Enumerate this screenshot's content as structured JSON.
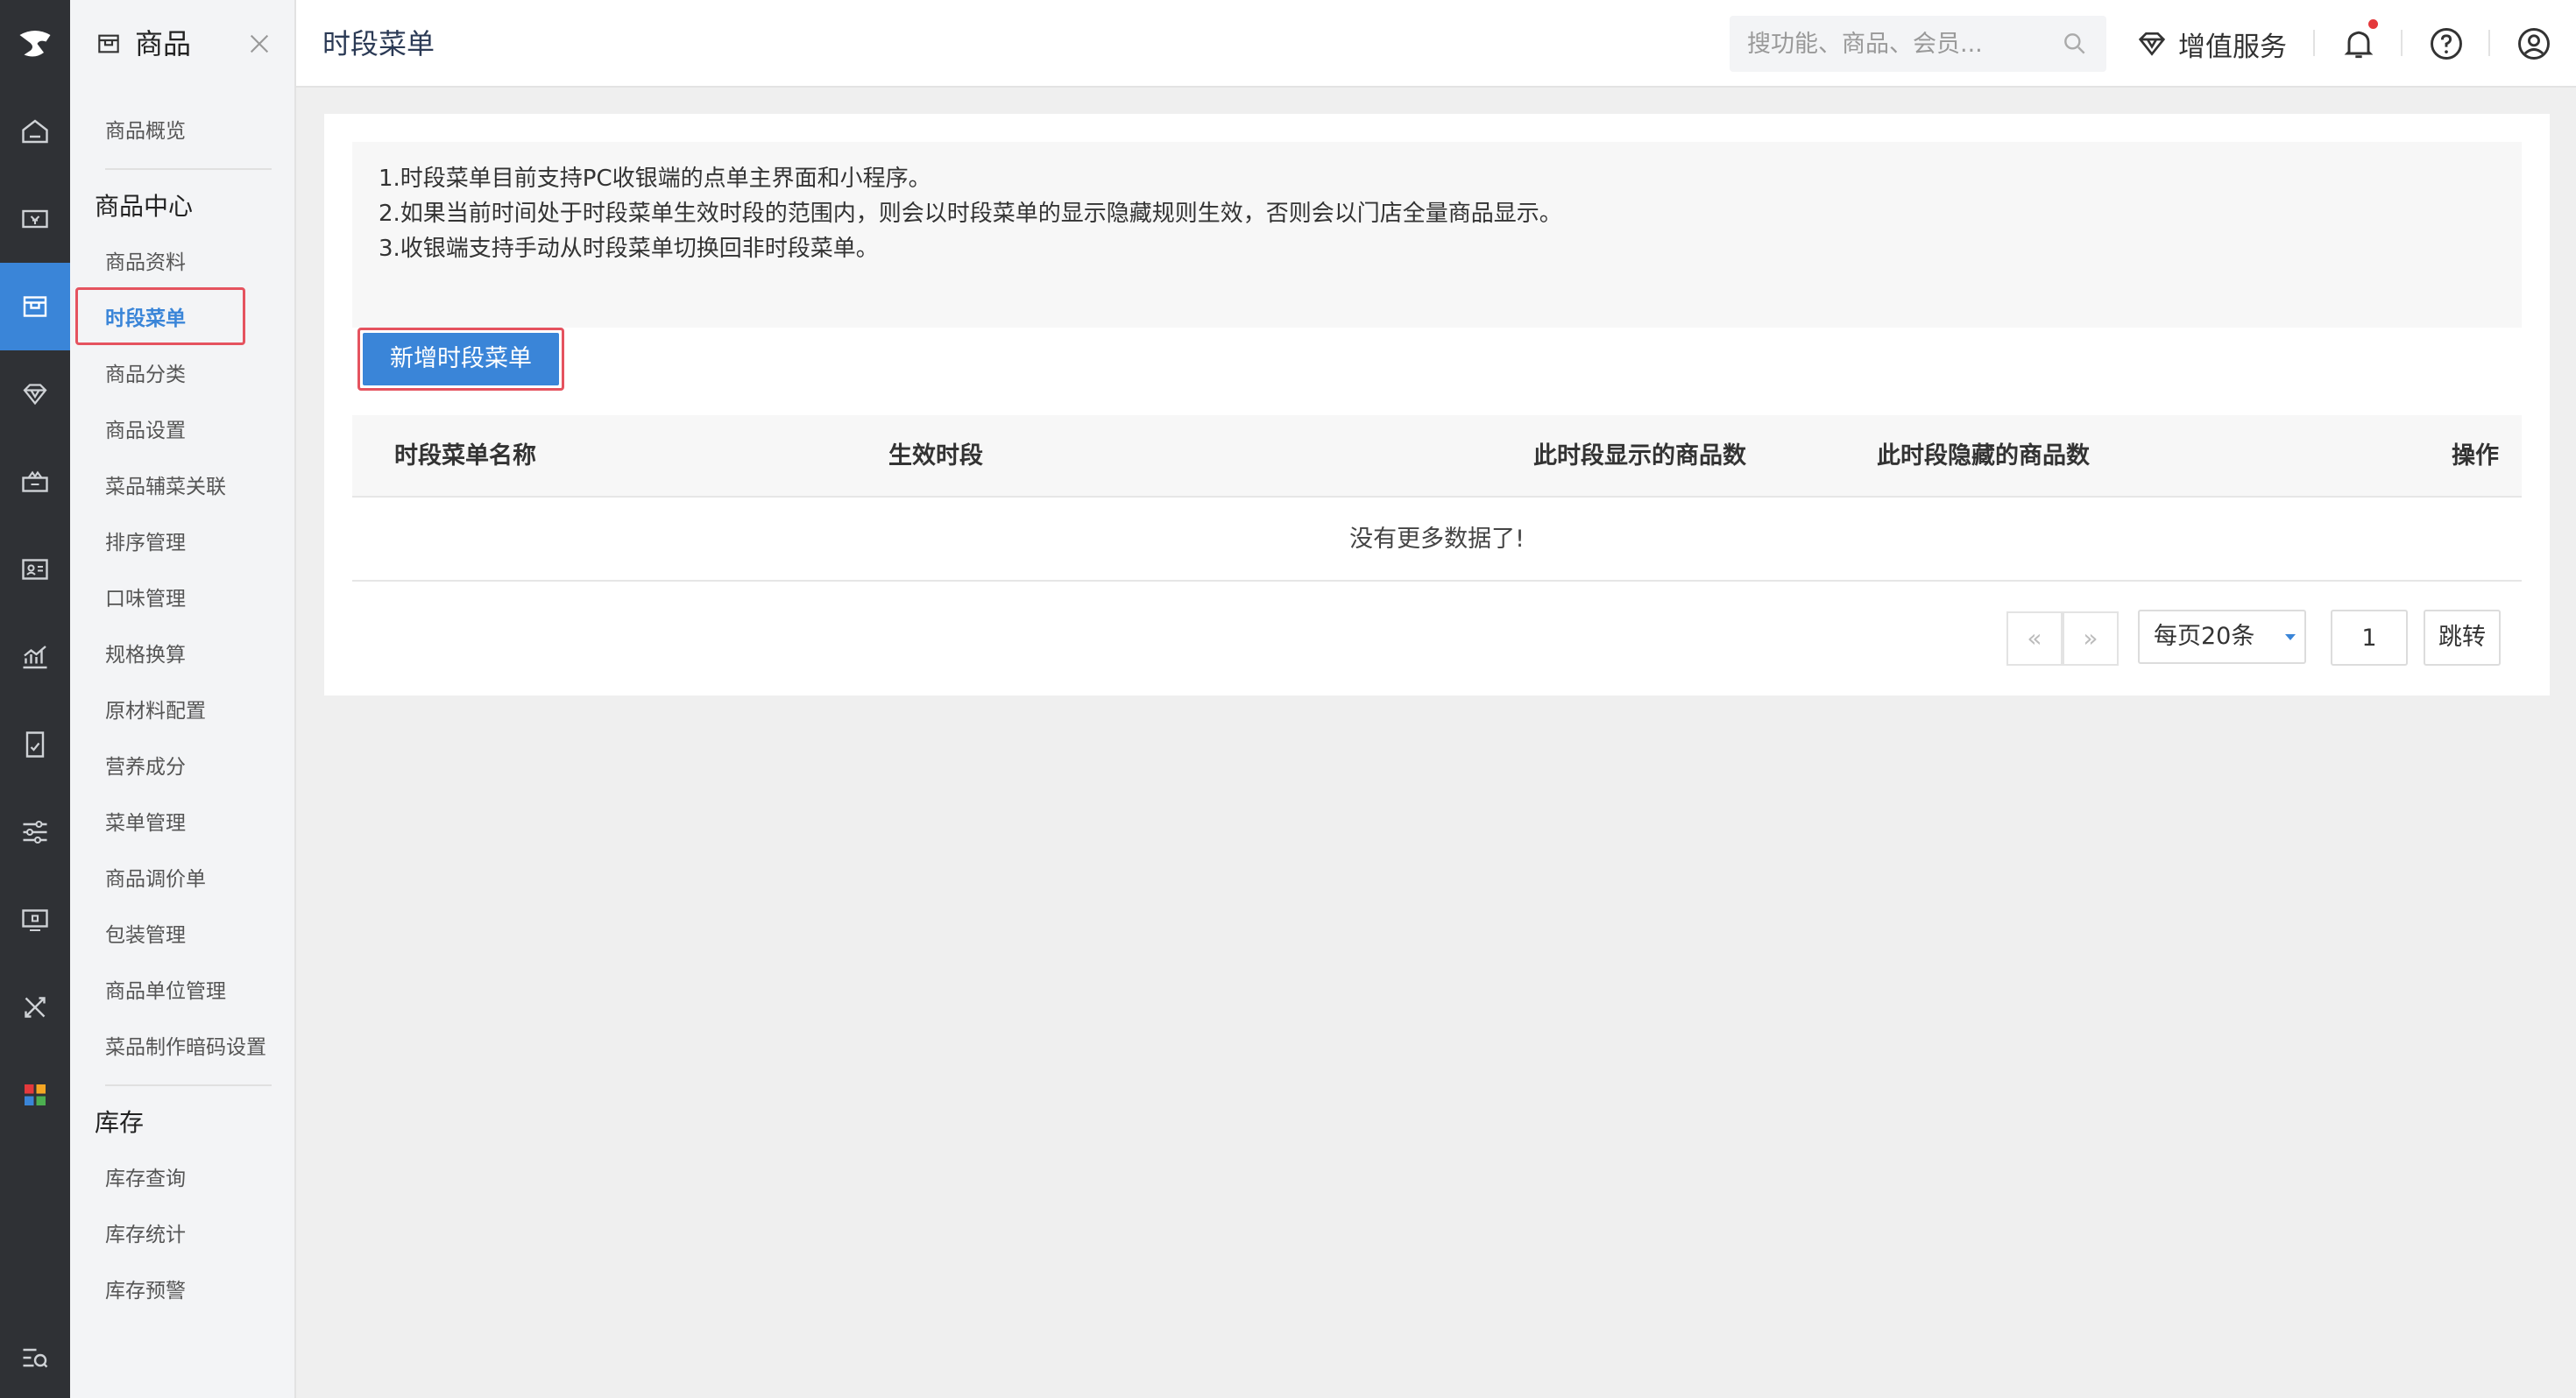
{
  "header": {
    "page_title": "时段菜单",
    "search_placeholder": "搜功能、商品、会员...",
    "value_added_label": "增值服务"
  },
  "subnav": {
    "module_title": "商品",
    "overview": "商品概览",
    "groups": [
      {
        "title": "商品中心",
        "items": [
          "商品资料",
          "时段菜单",
          "商品分类",
          "商品设置",
          "菜品辅菜关联",
          "排序管理",
          "口味管理",
          "规格换算",
          "原材料配置",
          "营养成分",
          "菜单管理",
          "商品调价单",
          "包装管理",
          "商品单位管理",
          "菜品制作暗码设置"
        ]
      },
      {
        "title": "库存",
        "items": [
          "库存查询",
          "库存统计",
          "库存预警"
        ]
      }
    ],
    "active_item": "时段菜单"
  },
  "rail": {
    "icons": [
      "home-icon",
      "cashier-icon",
      "goods-icon",
      "diamond-icon",
      "marketing-icon",
      "member-card-icon",
      "report-chart-icon",
      "finance-doc-icon",
      "settings-sliders-icon",
      "device-icon",
      "tools-icon",
      "apps-grid-icon"
    ],
    "active": "goods-icon",
    "bottom_icon": "search-menu-icon"
  },
  "notice": {
    "lines": [
      "1.时段菜单目前支持PC收银端的点单主界面和小程序。",
      "2.如果当前时间处于时段菜单生效时段的范围内，则会以时段菜单的显示隐藏规则生效，否则会以门店全量商品显示。",
      "3.收银端支持手动从时段菜单切换回非时段菜单。"
    ]
  },
  "actions": {
    "add_label": "新增时段菜单"
  },
  "table": {
    "columns": [
      "时段菜单名称",
      "生效时段",
      "此时段显示的商品数",
      "此时段隐藏的商品数",
      "操作"
    ],
    "rows": [],
    "empty_text": "没有更多数据了!"
  },
  "pagination": {
    "prev": "«",
    "next": "»",
    "page_size_label": "每页20条",
    "page_value": "1",
    "go_label": "跳转"
  },
  "colors": {
    "accent": "#3a85d8",
    "highlight": "#e5535f",
    "rail_bg": "#2f3135",
    "notify": "#e4393c"
  }
}
